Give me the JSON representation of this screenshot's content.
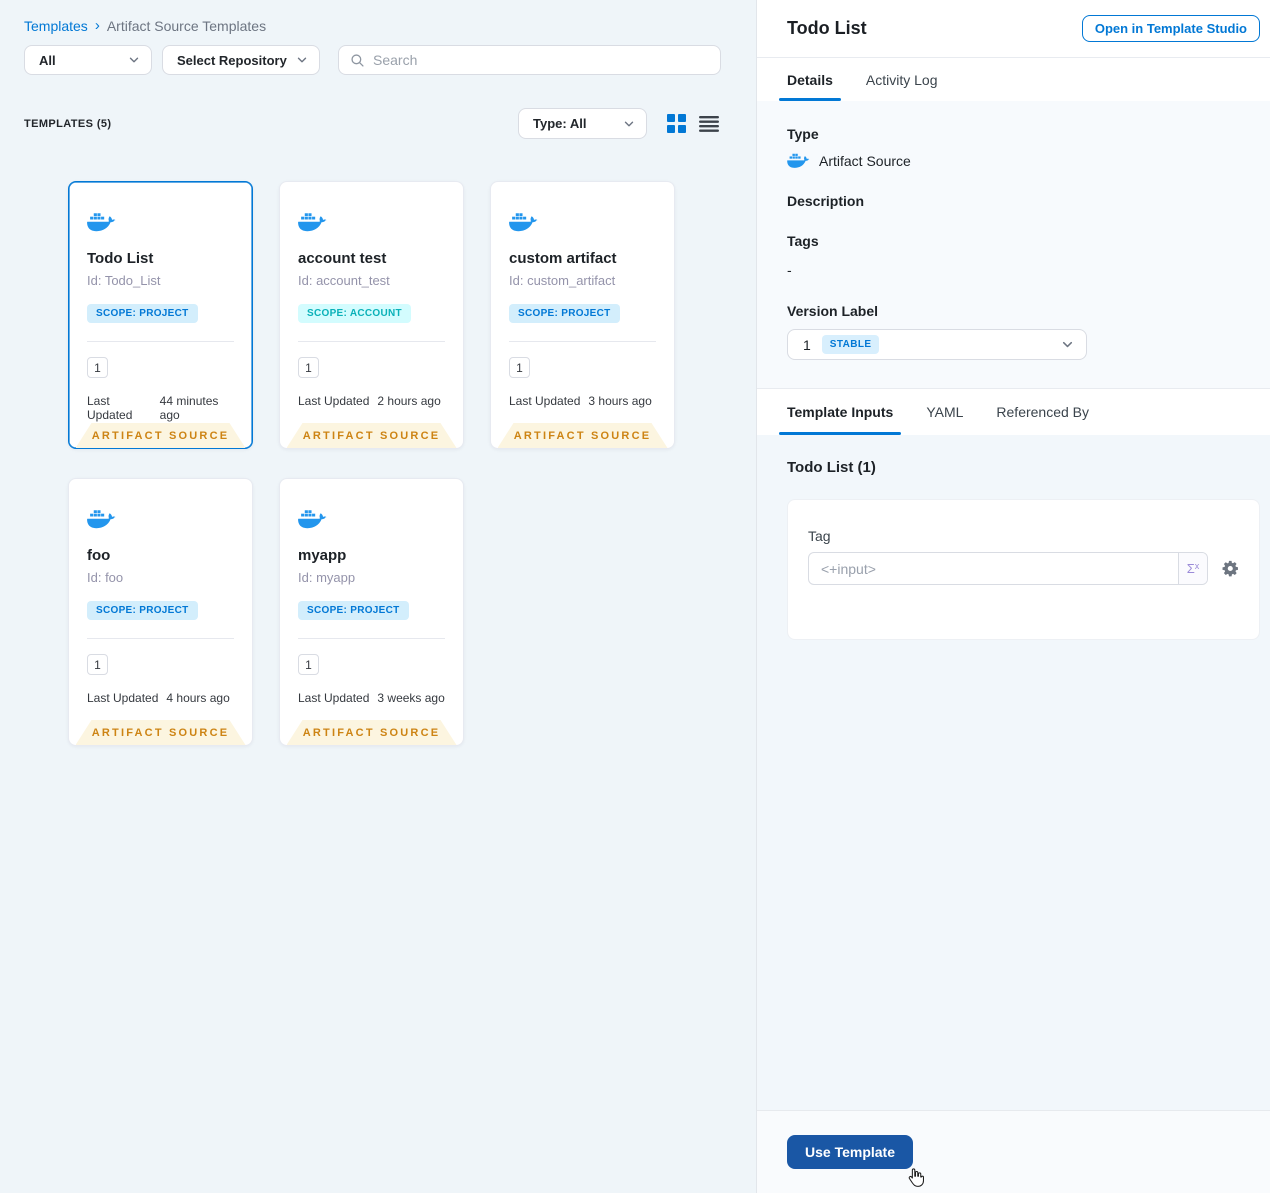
{
  "breadcrumb": {
    "templates": "Templates",
    "separator": "›",
    "current": "Artifact Source Templates"
  },
  "filters": {
    "scope": "All",
    "repository": "Select Repository",
    "search_placeholder": "Search"
  },
  "list_header": {
    "count": "TEMPLATES (5)",
    "type_filter": "Type: All"
  },
  "card_common": {
    "last_updated_label": "Last Updated",
    "footer": "ARTIFACT SOURCE"
  },
  "cards": [
    {
      "title": "Todo List",
      "id": "Id: Todo_List",
      "scope": "SCOPE: PROJECT",
      "versions": "1",
      "last_updated": "44 minutes ago"
    },
    {
      "title": "account test",
      "id": "Id: account_test",
      "scope": "SCOPE: ACCOUNT",
      "versions": "1",
      "last_updated": "2 hours ago"
    },
    {
      "title": "custom artifact",
      "id": "Id: custom_artifact",
      "scope": "SCOPE: PROJECT",
      "versions": "1",
      "last_updated": "3 hours ago"
    },
    {
      "title": "foo",
      "id": "Id: foo",
      "scope": "SCOPE: PROJECT",
      "versions": "1",
      "last_updated": "4 hours ago"
    },
    {
      "title": "myapp",
      "id": "Id: myapp",
      "scope": "SCOPE: PROJECT",
      "versions": "1",
      "last_updated": "3 weeks ago"
    }
  ],
  "panel": {
    "title": "Todo List",
    "open_in_studio": "Open in Template Studio",
    "tabs": {
      "details": "Details",
      "activity_log": "Activity Log"
    },
    "details": {
      "type_label": "Type",
      "type_value": "Artifact Source",
      "description_label": "Description",
      "tags_label": "Tags",
      "tags_value": "-",
      "version_label": "Version Label",
      "version_number": "1",
      "version_badge": "STABLE"
    },
    "inner_tabs": {
      "template_inputs": "Template Inputs",
      "yaml": "YAML",
      "referenced_by": "Referenced By"
    },
    "inputs": {
      "heading": "Todo List (1)",
      "tag_label": "Tag",
      "tag_value": "<+input>",
      "expression_symbol": "Σ",
      "expression_sub": "x"
    },
    "footer": {
      "use_template": "Use Template"
    }
  },
  "colors": {
    "primary": "#0278d5",
    "docker_blue": "#2396ed",
    "ribbon_text": "#cd8414",
    "ribbon_bg": "#fcf5e0",
    "scope_project_bg": "#d3eefc",
    "scope_account_bg": "#d3fcfe",
    "scope_account_text": "#0ab1b8",
    "stable_badge_bg": "#d8effd",
    "use_template_bg": "#1a57a5",
    "left_bg": "#eff5f9",
    "details_bg": "#f7fafd",
    "inputs_bg": "#f2f7fb"
  }
}
